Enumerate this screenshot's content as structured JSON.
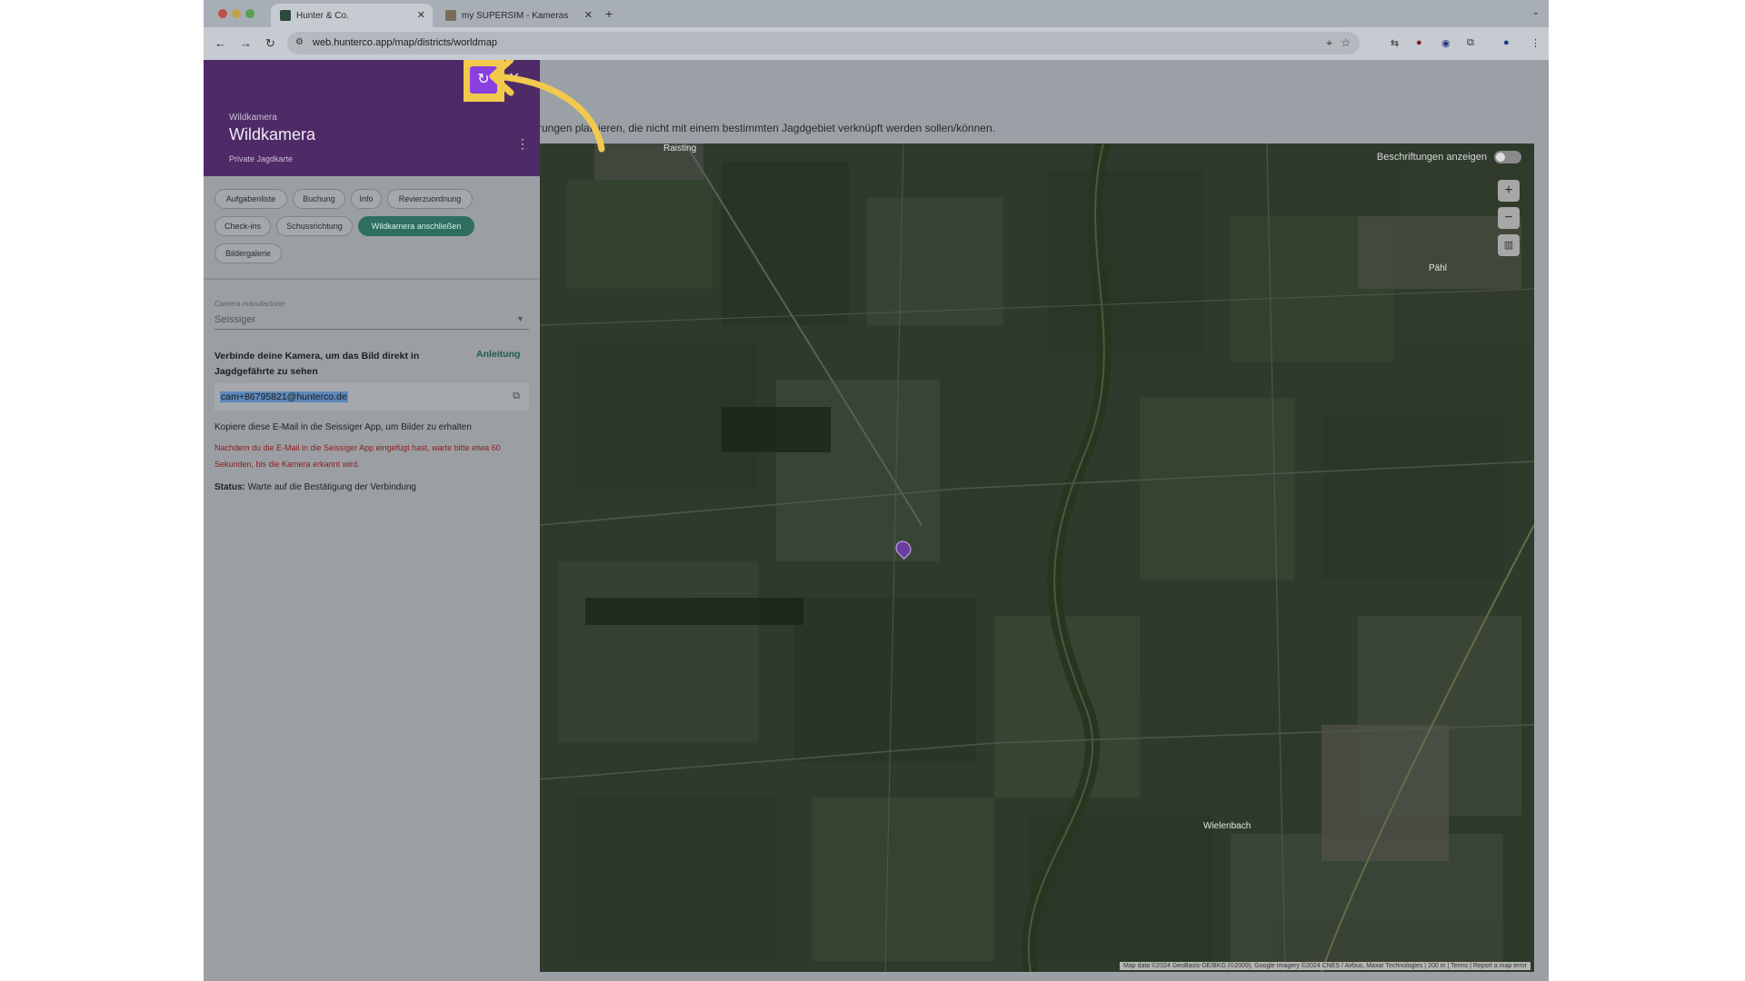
{
  "browser": {
    "tabs": [
      {
        "title": "Hunter & Co.",
        "active": true
      },
      {
        "title": "my SUPERSIM - Kameras",
        "active": false
      }
    ],
    "url": "web.hunterco.app/map/districts/worldmap"
  },
  "page": {
    "hint_text": "rungen platzieren, die nicht mit einem bestimmten Jagdgebiet verknüpft werden sollen/können."
  },
  "panel": {
    "sub_label": "Wildkamera",
    "title": "Wildkamera",
    "source": "Private Jagdkarte",
    "chips": [
      {
        "label": "Aufgabenliste",
        "active": false
      },
      {
        "label": "Buchung",
        "active": false
      },
      {
        "label": "Info",
        "active": false
      },
      {
        "label": "Revierzuordnung",
        "active": false
      },
      {
        "label": "Check-ins",
        "active": false
      },
      {
        "label": "Schussrichtung",
        "active": false
      },
      {
        "label": "Wildkamera anschließen",
        "active": true
      },
      {
        "label": "Bildergalerie",
        "active": false
      }
    ],
    "manufacturer_label": "Camera manufacturer",
    "manufacturer_value": "Seissiger",
    "connect_text": "Verbinde deine Kamera, um das Bild direkt in Jagdgefährte zu sehen",
    "guide_link": "Anleitung",
    "email": "cam+86795821@hunterco.de",
    "copy_hint": "Kopiere diese E-Mail in die Seissiger App, um Bilder zu erhalten",
    "warning": "Nachdem du die E-Mail in die Seissiger App eingefügt hast, warte bitte etwa 60 Sekunden, bis die Kamera erkannt wird.",
    "status_label": "Status:",
    "status_value": "Warte auf die Bestätigung der Verbindung"
  },
  "map": {
    "labels_toggle": "Beschriftungen anzeigen",
    "places": [
      "Raisting",
      "Wielenbach",
      "Pähl"
    ],
    "attribution": "Map data ©2024 GeoBasis-DE/BKG (©2009), Google Imagery ©2024 CNES / Airbus, Maxar Technologies | 200 m | Terms | Report a map error"
  },
  "colors": {
    "header": "#4e2a66",
    "accent": "#8a3fe0",
    "highlight": "#f2c94c",
    "active_chip": "#2e6e61"
  }
}
